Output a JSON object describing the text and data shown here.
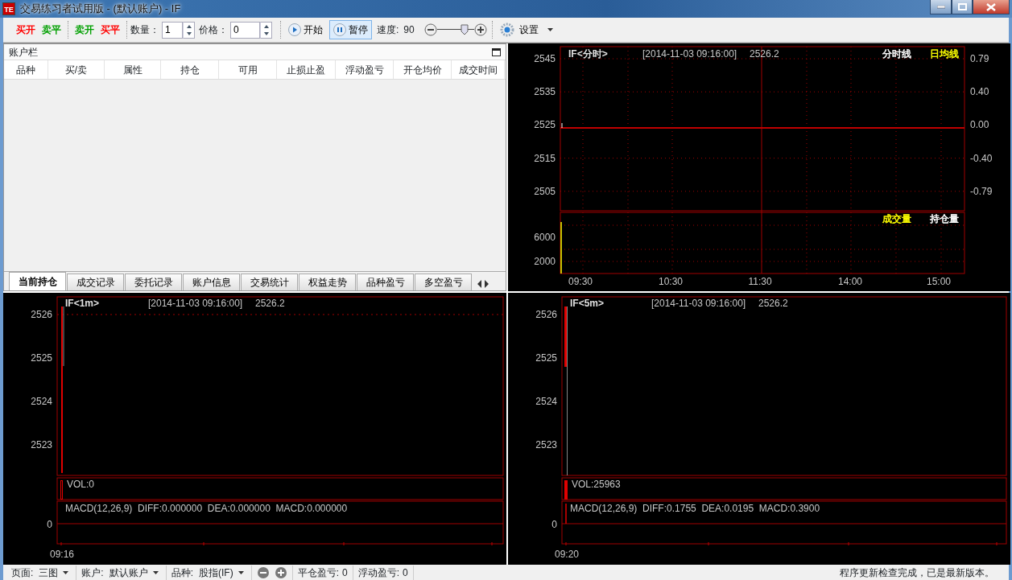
{
  "window": {
    "icon_text": "TE",
    "title": "交易练习者试用版 - (默认账户) - IF"
  },
  "toolbar": {
    "trade_buttons": [
      {
        "label": "买开",
        "color": "#ff0000"
      },
      {
        "label": "卖平",
        "color": "#00a000"
      },
      {
        "label": "卖开",
        "color": "#00a000"
      },
      {
        "label": "买平",
        "color": "#ff0000"
      }
    ],
    "quantity": {
      "label": "数量：",
      "value": "1"
    },
    "price": {
      "label": "价格：",
      "value": "0"
    },
    "play_buttons": [
      {
        "kind": "play",
        "label": "开始",
        "pressed": false
      },
      {
        "kind": "pause",
        "label": "暂停",
        "pressed": true
      }
    ],
    "speed": {
      "label": "速度:",
      "value": "90",
      "level": 0.75
    },
    "settings": {
      "label": "设置"
    }
  },
  "account_panel": {
    "title": "账户栏",
    "columns": [
      "品种",
      "买/卖",
      "属性",
      "持仓",
      "可用",
      "止损止盈",
      "浮动盈亏",
      "开仓均价",
      "成交时间"
    ],
    "tabs": [
      {
        "label": "当前持仓",
        "selected": true
      },
      {
        "label": "成交记录",
        "selected": false
      },
      {
        "label": "委托记录",
        "selected": false
      },
      {
        "label": "账户信息",
        "selected": false
      },
      {
        "label": "交易统计",
        "selected": false
      },
      {
        "label": "权益走势",
        "selected": false
      },
      {
        "label": "品种盈亏",
        "selected": false
      },
      {
        "label": "多空盈亏",
        "selected": false
      }
    ]
  },
  "intraday_chart": {
    "title": "IF<分时>",
    "timestamp": "[2014-11-03 09:16:00]",
    "price": "2526.2",
    "legends": [
      {
        "label": "分时线",
        "color": "#ffffff"
      },
      {
        "label": "日均线",
        "color": "#ffff00"
      }
    ],
    "y_labels": [
      "2545",
      "2535",
      "2525",
      "2515",
      "2505"
    ],
    "change_labels": [
      "0.79",
      "0.40",
      "0.00",
      "-0.40",
      "-0.79"
    ],
    "volume_legends": [
      {
        "label": "成交量",
        "color": "#ffff00"
      },
      {
        "label": "持仓量",
        "color": "#ffffff"
      }
    ],
    "volume_labels": [
      "6000",
      "2000"
    ],
    "x_labels": [
      "09:30",
      "10:30",
      "11:30",
      "14:00",
      "15:00"
    ]
  },
  "kline_charts": [
    {
      "title": "IF<1m>",
      "timestamp": "[2014-11-03 09:16:00]",
      "price": "2526.2",
      "y_labels": [
        "2526",
        "2525",
        "2524",
        "2523"
      ],
      "volume": "VOL:0",
      "macd": "MACD(12,26,9)  DIFF:0.000000  DEA:0.000000  MACD:0.000000",
      "macd_zero": "0",
      "x_label": "09:16"
    },
    {
      "title": "IF<5m>",
      "timestamp": "[2014-11-03 09:16:00]",
      "price": "2526.2",
      "y_labels": [
        "2526",
        "2525",
        "2524",
        "2523"
      ],
      "volume": "VOL:25963",
      "macd": "MACD(12,26,9)  DIFF:0.1755  DEA:0.0195  MACD:0.3900",
      "macd_zero": "0",
      "x_label": "09:20"
    }
  ],
  "status_bar": {
    "dropdowns": [
      {
        "label": "页面:",
        "value": "三图"
      },
      {
        "label": "账户:",
        "value": "默认账户"
      },
      {
        "label": "品种:",
        "value": "股指(IF)"
      }
    ],
    "readings": [
      {
        "label": "平仓盈亏:",
        "value": "0"
      },
      {
        "label": "浮动盈亏:",
        "value": "0"
      }
    ],
    "message": "程序更新检查完成，已是最新版本。"
  }
}
